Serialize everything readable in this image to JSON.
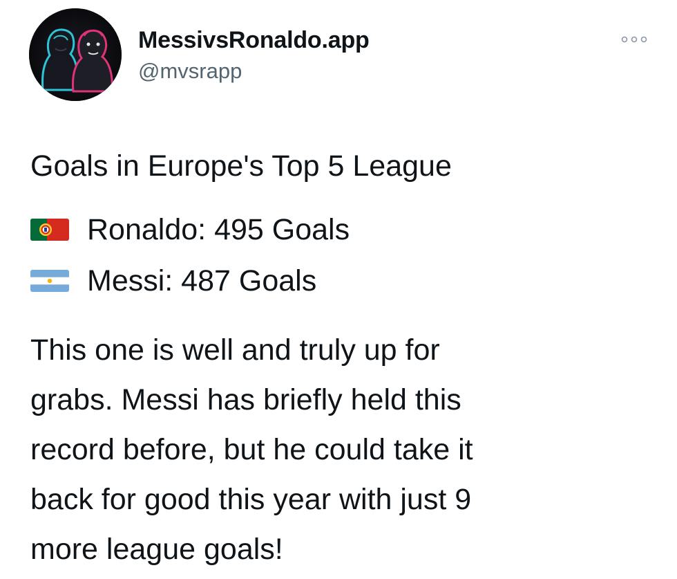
{
  "author": {
    "display_name": "MessivsRonaldo.app",
    "handle": "@mvsrapp",
    "avatar_icon": "messi-ronaldo-illustration-avatar"
  },
  "more_icon": "more-options-icon",
  "tweet": {
    "headline": "Goals in Europe's Top 5 League",
    "stats": [
      {
        "flag_icon": "portugal-flag-icon",
        "text": "Ronaldo: 495 Goals"
      },
      {
        "flag_icon": "argentina-flag-icon",
        "text": "Messi: 487 Goals"
      }
    ],
    "body_lines": [
      "This one is well and truly up for",
      "grabs. Messi has briefly held this",
      "record before, but he could take it",
      "back for good this year with just 9",
      "more league goals!"
    ]
  },
  "colors": {
    "text": "#0f1419",
    "secondary_text": "#536471",
    "avatar_glow_left": "#2ec4d6",
    "avatar_glow_right": "#e0337a"
  }
}
